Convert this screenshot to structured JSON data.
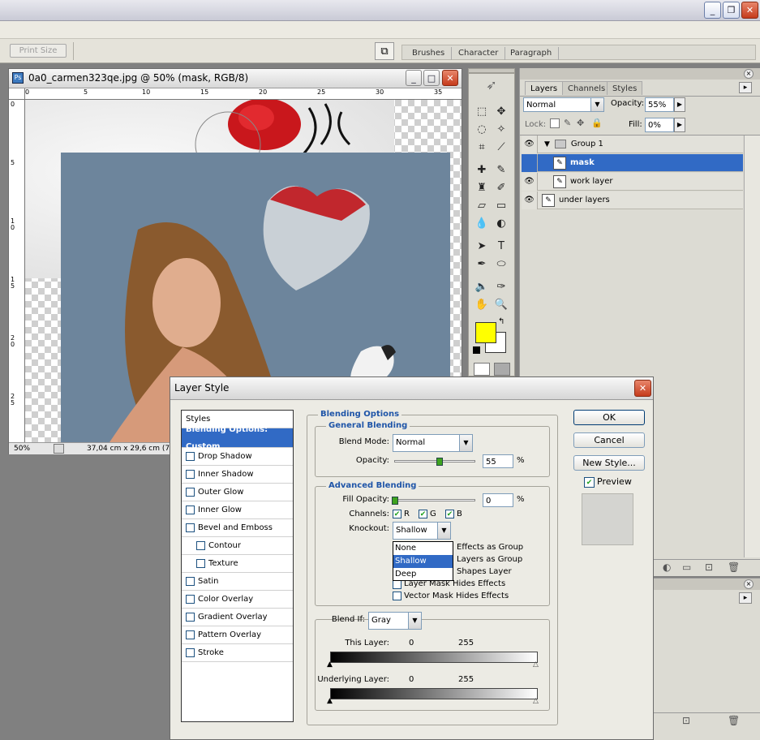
{
  "app": {
    "options_bar": {
      "print_size_label": "Print Size"
    },
    "well_tabs": [
      "Brushes",
      "Character",
      "Paragraph"
    ]
  },
  "document": {
    "title": "0a0_carmen323qe.jpg @ 50% (mask, RGB/8)",
    "ruler_top": [
      "0",
      "5",
      "10",
      "15",
      "20",
      "25",
      "30",
      "35"
    ],
    "ruler_left": [
      "0",
      "5",
      "1\n0",
      "1\n5",
      "2\n0",
      "2\n5"
    ],
    "zoom": "50%",
    "size_info": "37,04 cm x 29,6 cm (72"
  },
  "layers_panel": {
    "tabs": [
      "Layers",
      "Channels",
      "Styles"
    ],
    "blend_mode": "Normal",
    "opacity_label": "Opacity:",
    "opacity_value": "55%",
    "lock_label": "Lock:",
    "fill_label": "Fill:",
    "fill_value": "0%",
    "layers": [
      {
        "name": "Group 1",
        "type": "group",
        "selected": false
      },
      {
        "name": "mask",
        "type": "layer",
        "selected": true
      },
      {
        "name": "work layer",
        "type": "layer",
        "selected": false
      },
      {
        "name": "under layers",
        "type": "layer",
        "selected": false
      }
    ]
  },
  "colors": {
    "foreground": "#ffff00",
    "background": "#ffffff",
    "selection": "#316ac5",
    "canvas_bg": "#6d859c"
  },
  "dialog": {
    "title": "Layer Style",
    "styles_header": "Styles",
    "style_items": [
      {
        "label": "Blending Options: Custom",
        "selected": true,
        "checkbox": false,
        "indent": false
      },
      {
        "label": "Drop Shadow",
        "checkbox": true,
        "indent": false
      },
      {
        "label": "Inner Shadow",
        "checkbox": true,
        "indent": false
      },
      {
        "label": "Outer Glow",
        "checkbox": true,
        "indent": false
      },
      {
        "label": "Inner Glow",
        "checkbox": true,
        "indent": false
      },
      {
        "label": "Bevel and Emboss",
        "checkbox": true,
        "indent": false
      },
      {
        "label": "Contour",
        "checkbox": true,
        "indent": true
      },
      {
        "label": "Texture",
        "checkbox": true,
        "indent": true
      },
      {
        "label": "Satin",
        "checkbox": true,
        "indent": false
      },
      {
        "label": "Color Overlay",
        "checkbox": true,
        "indent": false
      },
      {
        "label": "Gradient Overlay",
        "checkbox": true,
        "indent": false
      },
      {
        "label": "Pattern Overlay",
        "checkbox": true,
        "indent": false
      },
      {
        "label": "Stroke",
        "checkbox": true,
        "indent": false
      }
    ],
    "blending_options_title": "Blending Options",
    "general_blending_title": "General Blending",
    "blend_mode_label": "Blend Mode:",
    "blend_mode_value": "Normal",
    "opacity_label": "Opacity:",
    "opacity_value": "55",
    "opacity_percent": 55,
    "percent": "%",
    "advanced_blending_title": "Advanced Blending",
    "fill_opacity_label": "Fill Opacity:",
    "fill_opacity_value": "0",
    "fill_opacity_percent": 0,
    "channels_label": "Channels:",
    "channels": [
      "R",
      "G",
      "B"
    ],
    "knockout_label": "Knockout:",
    "knockout_value": "Shallow",
    "knockout_options": [
      "None",
      "Shallow",
      "Deep"
    ],
    "knockout_selected": "Shallow",
    "checkbox_options": [
      "Blend Interior Effects as Group",
      "Blend Clipped Layers as Group",
      "Transparency Shapes Layer",
      "Layer Mask Hides Effects",
      "Vector Mask Hides Effects"
    ],
    "checkbox_visible_text": [
      "Effects as Group",
      "Layers as Group",
      "Shapes Layer",
      "Layer Mask Hides Effects",
      "Vector Mask Hides Effects"
    ],
    "blend_if_label": "Blend If:",
    "blend_if_value": "Gray",
    "this_layer_label": "This Layer:",
    "underlying_layer_label": "Underlying Layer:",
    "range_min": "0",
    "range_max": "255",
    "ok_label": "OK",
    "cancel_label": "Cancel",
    "new_style_label": "New Style...",
    "preview_label": "Preview"
  }
}
